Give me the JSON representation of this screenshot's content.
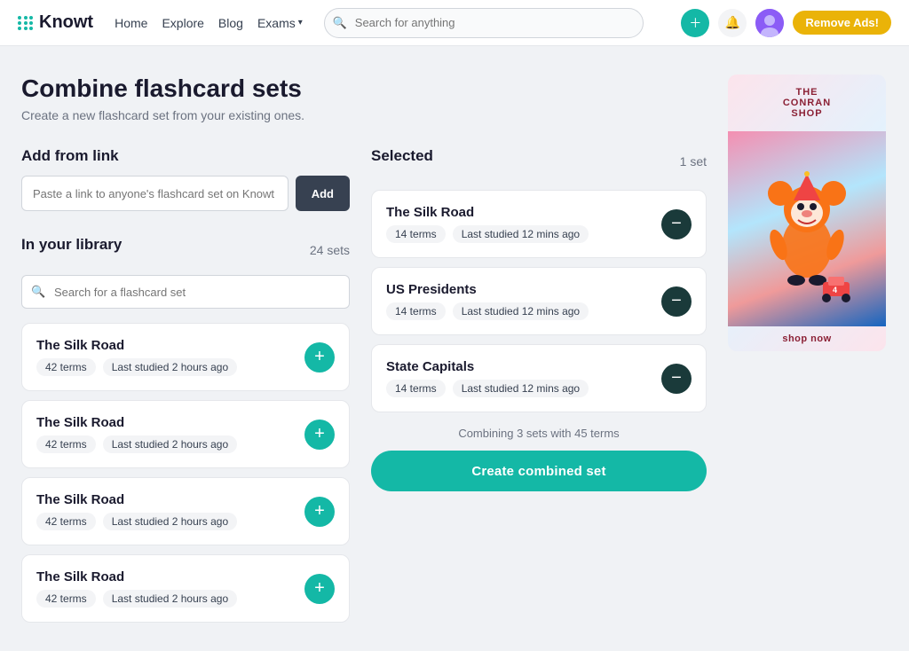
{
  "nav": {
    "logo": "Knowt",
    "links": [
      {
        "label": "Home",
        "id": "home"
      },
      {
        "label": "Explore",
        "id": "explore"
      },
      {
        "label": "Blog",
        "id": "blog"
      },
      {
        "label": "Exams",
        "id": "exams",
        "dropdown": true
      }
    ],
    "search_placeholder": "Search for anything",
    "remove_ads_label": "Remove Ads!"
  },
  "page": {
    "title": "Combine flashcard sets",
    "subtitle": "Create a new flashcard set from your existing ones."
  },
  "add_from_link": {
    "section_title": "Add from link",
    "input_placeholder": "Paste a link to anyone's flashcard set on Knowt",
    "button_label": "Add"
  },
  "library": {
    "section_title": "In your library",
    "count_label": "24 sets",
    "search_placeholder": "Search for a flashcard set",
    "cards": [
      {
        "title": "The Silk Road",
        "terms": "42 terms",
        "last_studied": "Last studied 2 hours ago"
      },
      {
        "title": "The Silk Road",
        "terms": "42 terms",
        "last_studied": "Last studied 2 hours ago"
      },
      {
        "title": "The Silk Road",
        "terms": "42 terms",
        "last_studied": "Last studied 2 hours ago"
      },
      {
        "title": "The Silk Road",
        "terms": "42 terms",
        "last_studied": "Last studied 2 hours ago"
      }
    ]
  },
  "selected": {
    "section_title": "Selected",
    "count_label": "1 set",
    "cards": [
      {
        "title": "The Silk Road",
        "terms": "14 terms",
        "last_studied": "Last studied 12 mins ago"
      },
      {
        "title": "US Presidents",
        "terms": "14 terms",
        "last_studied": "Last studied 12 mins ago"
      },
      {
        "title": "State Capitals",
        "terms": "14 terms",
        "last_studied": "Last studied 12 mins ago"
      }
    ],
    "combine_info": "Combining 3 sets with 45 terms",
    "combine_button": "Create combined set"
  },
  "ad": {
    "brand_line1": "THE",
    "brand_line2": "CONRAN",
    "brand_line3": "SHOP",
    "shop_now": "shop now"
  }
}
